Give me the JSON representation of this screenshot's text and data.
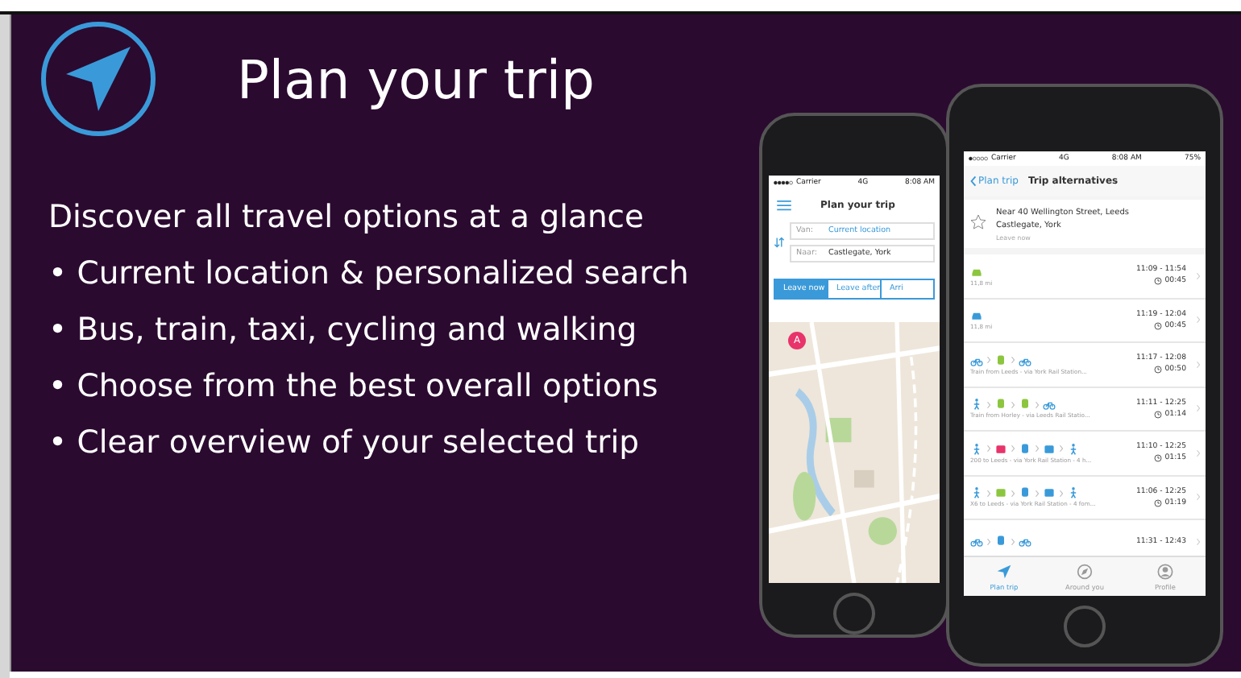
{
  "title": "Plan your trip",
  "intro": "Discover all travel options at a glance",
  "bullets": [
    "• Current location & personalized search",
    "• Bus, train, taxi, cycling and walking",
    "• Choose from the best overall options",
    "• Clear overview of your selected trip"
  ],
  "back_phone": {
    "status": {
      "carrier": "Carrier",
      "network": "4G",
      "time": "8:08 AM"
    },
    "title": "Plan your trip",
    "fields": [
      {
        "label": "Van:",
        "value": "Current location",
        "kind": "link"
      },
      {
        "label": "Naar:",
        "value": "Castlegate, York",
        "kind": "plain"
      }
    ],
    "segments": [
      {
        "label": "Leave now",
        "selected": true
      },
      {
        "label": "Leave after",
        "selected": false
      },
      {
        "label": "Arri",
        "selected": false
      }
    ],
    "map": {
      "kind": "picture",
      "pin_label": "A"
    }
  },
  "front_phone": {
    "status": {
      "carrier": "Carrier",
      "network": "4G",
      "time": "8:08 AM",
      "battery": "75%"
    },
    "back": "Plan trip",
    "title": "Trip alternatives",
    "from": "Near 40 Wellington Street, Leeds",
    "to": "Castlegate, York",
    "when": "Leave now",
    "trips": [
      {
        "legs": [
          {
            "kind": "car",
            "color": "#8cc63f"
          }
        ],
        "times": "11:09 - 11:54",
        "duration": "00:45",
        "note": "11,8 mi"
      },
      {
        "legs": [
          {
            "kind": "car",
            "color": "#3a9ad9"
          }
        ],
        "times": "11:19 - 12:04",
        "duration": "00:45",
        "note": "11,8 mi"
      },
      {
        "legs": [
          {
            "kind": "bike",
            "color": "#3a9ad9"
          },
          {
            "kind": "train",
            "color": "#8cc63f"
          },
          {
            "kind": "bike",
            "color": "#3a9ad9"
          }
        ],
        "times": "11:17 - 12:08",
        "duration": "00:50",
        "note": "Train from Leeds - via York Rail Station..."
      },
      {
        "legs": [
          {
            "kind": "walk",
            "color": "#3a9ad9"
          },
          {
            "kind": "train",
            "color": "#8cc63f"
          },
          {
            "kind": "train",
            "color": "#8cc63f"
          },
          {
            "kind": "bike",
            "color": "#3a9ad9"
          }
        ],
        "times": "11:11 - 12:25",
        "duration": "01:14",
        "note": "Train from Horley - via Leeds Rail Statio..."
      },
      {
        "legs": [
          {
            "kind": "walk",
            "color": "#3a9ad9"
          },
          {
            "kind": "bus",
            "color": "#e8336b"
          },
          {
            "kind": "train",
            "color": "#3a9ad9"
          },
          {
            "kind": "bus",
            "color": "#3a9ad9"
          },
          {
            "kind": "walk",
            "color": "#3a9ad9"
          }
        ],
        "times": "11:10 - 12:25",
        "duration": "01:15",
        "note": "200 to Leeds - via York Rail Station - 4 h..."
      },
      {
        "legs": [
          {
            "kind": "walk",
            "color": "#3a9ad9"
          },
          {
            "kind": "bus",
            "color": "#8cc63f"
          },
          {
            "kind": "train",
            "color": "#3a9ad9"
          },
          {
            "kind": "bus",
            "color": "#3a9ad9"
          },
          {
            "kind": "walk",
            "color": "#3a9ad9"
          }
        ],
        "times": "11:06 - 12:25",
        "duration": "01:19",
        "note": "X6 to Leeds - via York Rail Station - 4 fom..."
      },
      {
        "legs": [
          {
            "kind": "bike",
            "color": "#3a9ad9"
          },
          {
            "kind": "train",
            "color": "#3a9ad9"
          },
          {
            "kind": "bike",
            "color": "#3a9ad9"
          }
        ],
        "times": "11:31 - 12:43"
      }
    ],
    "tabs": [
      {
        "label": "Plan trip",
        "kind": "plan",
        "selected": true
      },
      {
        "label": "Around you",
        "kind": "around",
        "selected": false
      },
      {
        "label": "Profile",
        "kind": "profile",
        "selected": false
      }
    ]
  }
}
